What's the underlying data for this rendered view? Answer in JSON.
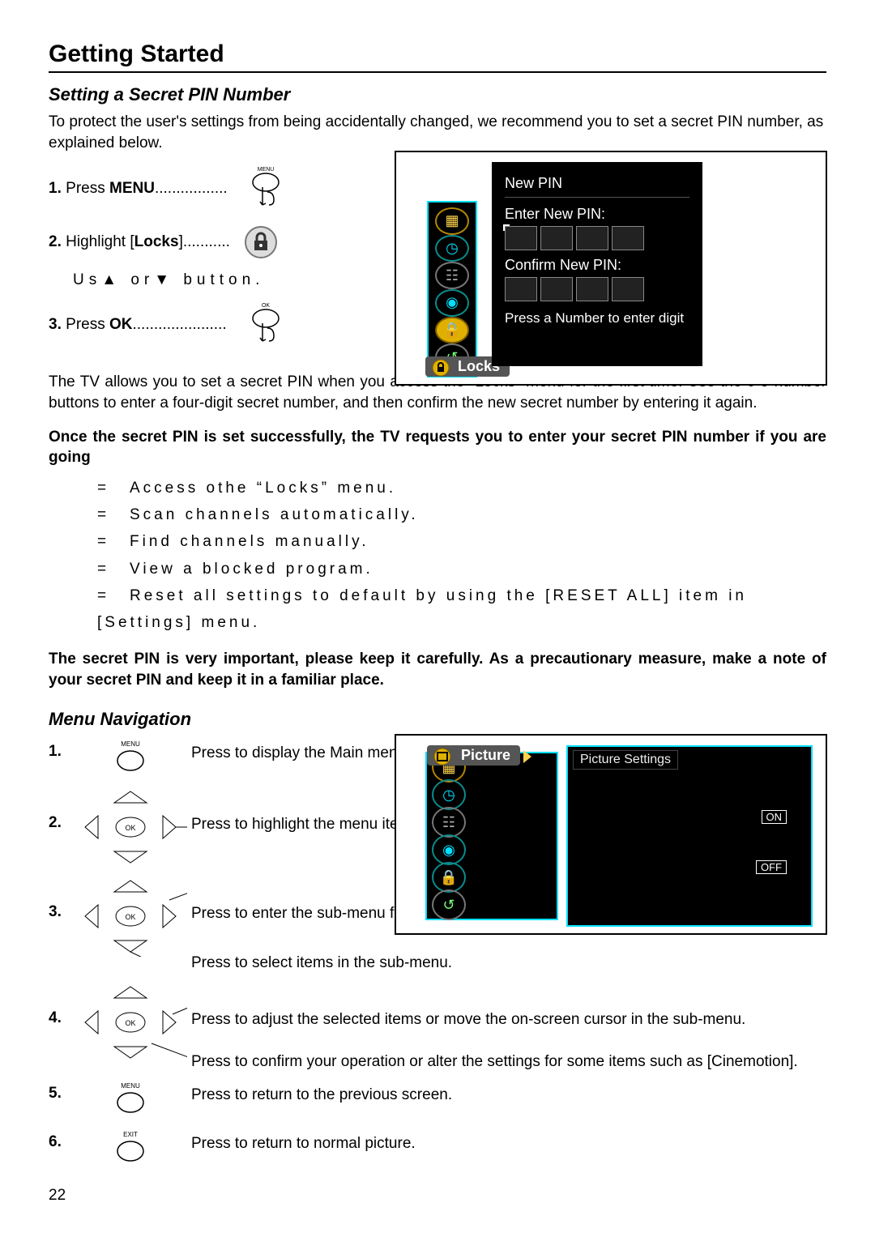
{
  "title": "Getting Started",
  "section1": {
    "heading": "Setting a Secret PIN Number",
    "intro": "To protect the user's settings from being accidentally changed, we recommend you to set a secret PIN number, as explained below.",
    "steps": {
      "s1_num": "1.",
      "s1_text_a": "Press ",
      "s1_text_b": "MENU",
      "s1_text_c": ".................",
      "s2_num": "2.",
      "s2_text_a": "Highlight [",
      "s2_text_b": "Locks",
      "s2_text_c": "]...........",
      "s2_hint_a": "Us",
      "s2_hint_tri_up": "▲",
      "s2_hint_b": " or",
      "s2_hint_tri_dn": "▼",
      "s2_hint_c": " button.",
      "s3_num": "3.",
      "s3_text_a": "Press ",
      "s3_text_b": "OK",
      "s3_text_c": "......................"
    },
    "screen": {
      "title": "New PIN",
      "enter_label": "Enter New PIN:",
      "confirm_label": "Confirm New PIN:",
      "prompt": "Press a Number to enter digit",
      "sidebar_selected": "Locks"
    },
    "after_para": "The TV allows you to set a secret PIN when you access the \"Locks\" menu for the first time. Use the 0-9 number buttons to enter a four-digit secret number, and then confirm the new secret number by entering it again.",
    "lead_bold": "Once the secret PIN is set successfully, the TV requests you to enter your secret PIN number if you are going",
    "bullets": [
      "Access othe “Locks” menu.",
      "Scan channels automatically.",
      "Find channels manually.",
      "View a blocked program.",
      "Reset all settings to default by using the [RESET ALL] item in [Settings] menu."
    ],
    "warn_bold": "The secret PIN is very important, please keep it carefully. As a precautionary measure, make a note of your secret PIN and keep it in a familiar place."
  },
  "section2": {
    "heading": "Menu Navigation",
    "rows": {
      "r1_num": "1.",
      "r1_desc": "Press to display the Main menu.",
      "r2_num": "2.",
      "r2_desc": "Press to highlight the menu items.",
      "r3_num": "3.",
      "r3_desc_a": "Press to enter the sub-menu field.",
      "r3_desc_b": "Press to select items in the sub-menu.",
      "r4_num": "4.",
      "r4_desc_a": "Press to adjust the selected items or move the on-screen cursor in the sub-menu.",
      "r4_desc_b": "Press to confirm your operation or alter the settings for some items such as [Cinemotion].",
      "r5_num": "5.",
      "r5_desc": "Press to return to the previous screen.",
      "r6_num": "6.",
      "r6_desc": "Press to return to normal picture."
    },
    "screen": {
      "sidebar_selected": "Picture",
      "panel_title": "Picture Settings",
      "on_label": "ON",
      "off_label": "OFF"
    }
  },
  "icon_labels": {
    "menu": "MENU",
    "ok": "OK",
    "exit": "EXIT"
  },
  "page_number": "22"
}
